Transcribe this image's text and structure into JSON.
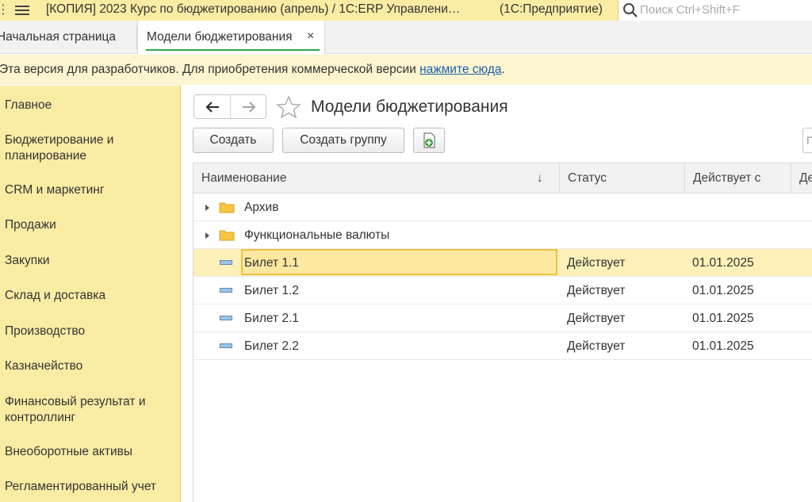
{
  "titlebar": {
    "title": "[КОПИЯ] 2023 Курс по бюджетированию (апрель) / 1С:ERP Управлени…",
    "app": "(1С:Предприятие)",
    "search_placeholder": "Поиск Ctrl+Shift+F"
  },
  "tabs": [
    {
      "label": "Начальная страница"
    },
    {
      "label": "Модели бюджетирования",
      "close": "×"
    }
  ],
  "notice": {
    "text": "Эта версия для разработчиков. Для приобретения коммерческой версии ",
    "link": "нажмите сюда",
    "end": "."
  },
  "sidebar": {
    "items": [
      {
        "label": "Главное"
      },
      {
        "label": "Бюджетирование и планирование"
      },
      {
        "label": "CRM и маркетинг"
      },
      {
        "label": "Продажи"
      },
      {
        "label": "Закупки"
      },
      {
        "label": "Склад и доставка"
      },
      {
        "label": "Производство"
      },
      {
        "label": "Казначейство"
      },
      {
        "label": "Финансовый результат и контроллинг"
      },
      {
        "label": "Внеоборотные активы"
      },
      {
        "label": "Регламентированный учет"
      }
    ]
  },
  "main": {
    "title": "Модели бюджетирования",
    "buttons": {
      "create": "Создать",
      "create_group": "Создать группу"
    },
    "search_cut": "П"
  },
  "table": {
    "columns": {
      "name": "Наименование",
      "sort": "↓",
      "status": "Статус",
      "date": "Действует с",
      "extra": "Де"
    },
    "rows": [
      {
        "name": "Архив",
        "status": "",
        "date": "",
        "type": "folder"
      },
      {
        "name": "Функциональные валюты",
        "status": "",
        "date": "",
        "type": "folder"
      },
      {
        "name": "Билет 1.1",
        "status": "Действует",
        "date": "01.01.2025",
        "type": "item",
        "selected": true
      },
      {
        "name": "Билет 1.2",
        "status": "Действует",
        "date": "01.01.2025",
        "type": "item"
      },
      {
        "name": "Билет 2.1",
        "status": "Действует",
        "date": "01.01.2025",
        "type": "item"
      },
      {
        "name": "Билет 2.2",
        "status": "Действует",
        "date": "01.01.2025",
        "type": "item"
      }
    ]
  },
  "colors": {
    "sidebar_bg": "#fbeca4",
    "notice_bg": "#fdf5d0",
    "link": "#1a5fa8",
    "selection": "#fde8a0",
    "tab_underline": "#2aa84a"
  }
}
